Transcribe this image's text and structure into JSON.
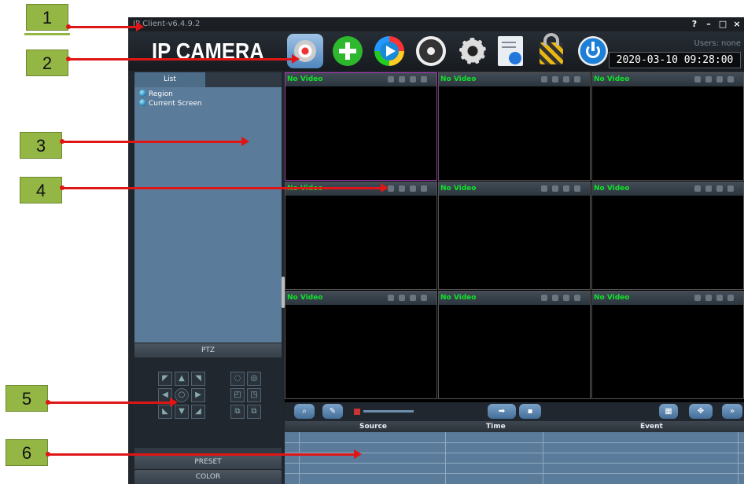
{
  "window": {
    "title": "IP Client-v6.4.9.2",
    "controls": [
      "?",
      "–",
      "□",
      "×"
    ]
  },
  "header": {
    "brand": "IP CAMERA",
    "users": "Users: none",
    "datetime": "2020-03-10  09:28:00",
    "toolbar": [
      {
        "icon": "webcam-icon",
        "active": true
      },
      {
        "icon": "add-device-icon"
      },
      {
        "icon": "playback-icon"
      },
      {
        "icon": "ptz-control-icon"
      },
      {
        "icon": "settings-gear-icon"
      },
      {
        "icon": "log-document-icon"
      },
      {
        "icon": "lock-icon"
      },
      {
        "icon": "power-icon"
      }
    ]
  },
  "left_panel": {
    "tab": "List",
    "tree": [
      "Region",
      "Current Screen"
    ],
    "ptz_label": "PTZ",
    "preset_label": "PRESET",
    "color_label": "COLOR"
  },
  "video_grid": {
    "cells": [
      "No Video",
      "No Video",
      "No Video",
      "No Video",
      "No Video",
      "No Video",
      "No Video",
      "No Video",
      "No Video"
    ]
  },
  "events": {
    "columns": [
      "Source",
      "Time",
      "Event"
    ]
  },
  "annotations": [
    "1",
    "2",
    "3",
    "4",
    "5",
    "6"
  ]
}
